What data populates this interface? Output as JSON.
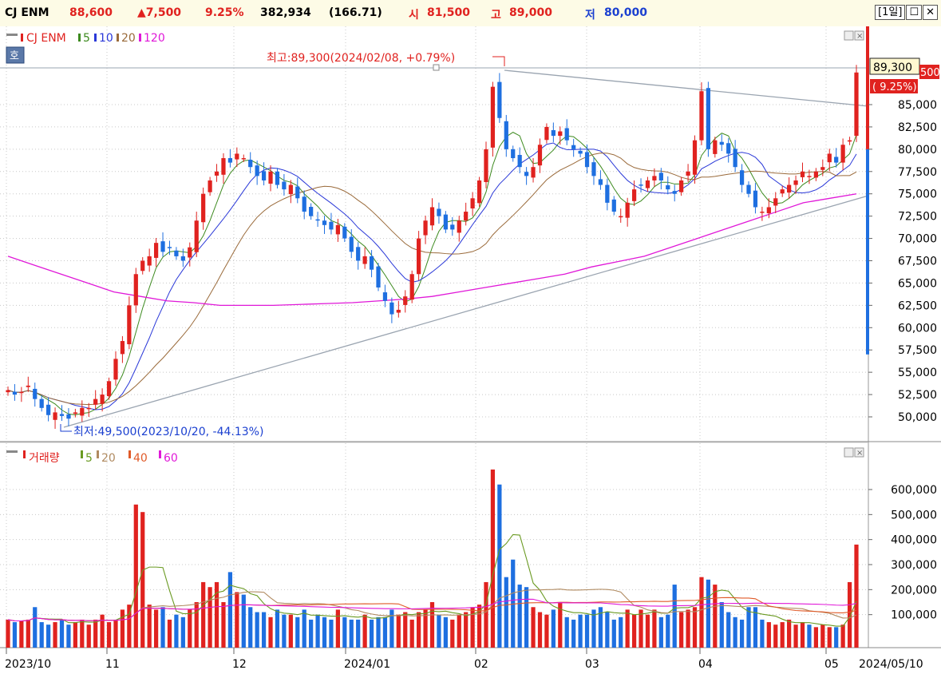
{
  "quote": {
    "name": "CJ ENM",
    "price": "88,600",
    "change": "▲7,500",
    "change_pct": "9.25%",
    "volume": "382,934",
    "volume_ratio": "(166.71)",
    "open_label": "시",
    "open": "81,500",
    "high_label": "고",
    "high": "89,000",
    "low_label": "저",
    "low": "80,000"
  },
  "window": {
    "period": "[1일]",
    "restore_icon": "☐",
    "close_icon": "✕"
  },
  "price_panel": {
    "legend": {
      "name": "CJ ENM",
      "ma": [
        "5",
        "10",
        "20",
        "120"
      ]
    },
    "ho_button": "호",
    "max_annotation": "최고:89,300(2024/02/08, +0.79%)",
    "min_annotation": "최저:49,500(2023/10/20, -44.13%)",
    "last_box_price": "89,300",
    "last_box_pct": "( 9.25%)",
    "hidden_tag": "500",
    "y_ticks": [
      "85,000",
      "82,500",
      "80,000",
      "77,500",
      "75,000",
      "72,500",
      "70,000",
      "67,500",
      "65,000",
      "62,500",
      "60,000",
      "57,500",
      "55,000",
      "52,500",
      "50,000"
    ],
    "colors": {
      "up": "#e0221f",
      "down": "#1e6fe0",
      "ma5": "#3c8a1e",
      "ma10": "#2a38d8",
      "ma20": "#9a6a3a",
      "ma120": "#e018d8"
    }
  },
  "volume_panel": {
    "legend": {
      "name": "거래량",
      "ma": [
        "5",
        "20",
        "40",
        "60"
      ]
    },
    "y_ticks": [
      "600,000",
      "500,000",
      "400,000",
      "300,000",
      "200,000",
      "100,000"
    ],
    "colors": {
      "ma5": "#6a9a22",
      "ma20": "#b08a60",
      "ma40": "#e05a28",
      "ma60": "#e018d8"
    }
  },
  "x_axis": {
    "labels": [
      "2023/10",
      "11",
      "12",
      "2024/01",
      "02",
      "03",
      "04",
      "05"
    ],
    "last_date": "2024/05/10"
  },
  "chart_data": [
    {
      "type": "candlestick",
      "title": "CJ ENM",
      "x_range": [
        "2023/10",
        "2024/05/10"
      ],
      "ylim": [
        48000,
        91000
      ],
      "series_close": [
        53000,
        52500,
        52800,
        53500,
        52000,
        51000,
        50200,
        50500,
        50100,
        49800,
        50500,
        51000,
        51000,
        52000,
        52500,
        54000,
        56500,
        58500,
        62500,
        66000,
        67500,
        68000,
        69500,
        68500,
        69000,
        68000,
        67500,
        69000,
        72000,
        75000,
        76500,
        77500,
        79000,
        78500,
        79500,
        79000,
        78000,
        77000,
        76500,
        77500,
        76000,
        75500,
        76000,
        74500,
        73000,
        72500,
        72000,
        71500,
        71000,
        71500,
        70000,
        68500,
        67500,
        68000,
        66500,
        64500,
        63000,
        61500,
        62000,
        63500,
        66000,
        70000,
        72000,
        73500,
        72500,
        71000,
        71000,
        72000,
        73000,
        74500,
        76500,
        80000,
        87000,
        83500,
        80000,
        79000,
        78000,
        77000,
        78000,
        80500,
        82500,
        81500,
        82000,
        81000,
        80000,
        79500,
        78000,
        77000,
        76000,
        74000,
        73000,
        72500,
        74000,
        75500,
        76000,
        76500,
        77000,
        76500,
        75500,
        75000,
        76500,
        77500,
        81000,
        86500,
        80000,
        81000,
        80500,
        79500,
        78000,
        76000,
        75000,
        73500,
        73000,
        73500,
        74500,
        75500,
        76000,
        76500,
        77500,
        77000,
        77500,
        78000,
        79500,
        78500,
        80500,
        81000,
        88600
      ],
      "series_ma120_approx": [
        68000,
        67000,
        66000,
        65000,
        64000,
        63500,
        63000,
        62800,
        62500,
        62500,
        62500,
        62600,
        62700,
        62800,
        63000,
        63200,
        63500,
        64000,
        64500,
        65000,
        65500,
        66000,
        66800,
        67400,
        68000,
        69000,
        70000,
        71000,
        72000,
        73000,
        74000,
        74500,
        75000
      ],
      "max": {
        "value": 89300,
        "date": "2024/02/08"
      },
      "min": {
        "value": 49500,
        "date": "2023/10/20"
      }
    },
    {
      "type": "bar",
      "title": "거래량",
      "ylim": [
        0,
        700000
      ],
      "values": [
        80000,
        70000,
        75000,
        80000,
        130000,
        70000,
        60000,
        70000,
        80000,
        60000,
        70000,
        80000,
        60000,
        80000,
        100000,
        70000,
        80000,
        120000,
        140000,
        540000,
        510000,
        140000,
        120000,
        130000,
        80000,
        100000,
        90000,
        120000,
        150000,
        230000,
        210000,
        230000,
        150000,
        270000,
        190000,
        180000,
        130000,
        110000,
        110000,
        90000,
        120000,
        100000,
        100000,
        90000,
        120000,
        80000,
        100000,
        90000,
        80000,
        120000,
        90000,
        80000,
        80000,
        100000,
        80000,
        90000,
        90000,
        120000,
        100000,
        110000,
        80000,
        110000,
        120000,
        150000,
        100000,
        90000,
        80000,
        100000,
        110000,
        130000,
        140000,
        230000,
        680000,
        620000,
        250000,
        320000,
        220000,
        210000,
        130000,
        110000,
        100000,
        120000,
        150000,
        90000,
        80000,
        100000,
        100000,
        120000,
        130000,
        110000,
        80000,
        90000,
        120000,
        100000,
        120000,
        100000,
        120000,
        90000,
        100000,
        220000,
        110000,
        120000,
        130000,
        250000,
        240000,
        220000,
        150000,
        110000,
        90000,
        80000,
        130000,
        130000,
        80000,
        70000,
        60000,
        70000,
        80000,
        60000,
        70000,
        60000,
        50000,
        60000,
        50000,
        50000,
        60000,
        230000,
        380000
      ]
    }
  ]
}
